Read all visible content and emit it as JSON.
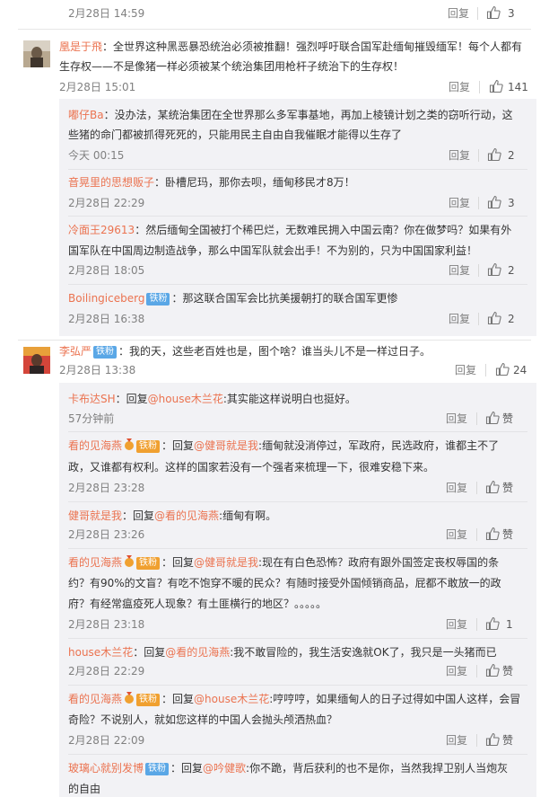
{
  "actions": {
    "reply": "回复",
    "like_icon": "thumbs-up-icon",
    "zan": "赞"
  },
  "colors": {
    "name": "#eb7350",
    "blue_badge": "#5aa7e6",
    "orange_badge": "#f0a030"
  },
  "comments": [
    {
      "id": "top",
      "time": "2月28日 14:59",
      "likes": "3"
    },
    {
      "id": "feng",
      "user": "凰是于飛",
      "text_line1": "：全世界这种黑恶暴恐统治必须被推翻！强烈呼吁联合国军赴缅甸摧毁缅军！每个人都有",
      "text_line2": "生存权——不是像猪一样必须被某个统治集团用枪杆子统治下的生存权！",
      "time": "2月28日 15:01",
      "likes": "141",
      "replies": [
        {
          "user": "嘟仔Ba",
          "line1": "：没办法，某统治集团在全世界那么多军事基地，再加上棱镜计划之类的窃听行动，这",
          "line2": "些猪的命门都被抓得死死的，只能用民主自由自我催眠才能得以生存了",
          "time": "今天 00:15",
          "likes": "2"
        },
        {
          "user": "音晃里的思想贩子",
          "line1": "：卧槽尼玛，那你去呗，缅甸移民才8万！",
          "time": "2月28日 22:29",
          "likes": "3"
        },
        {
          "user": "冷面王29613",
          "line1": "：然后缅甸全国被打个稀巴烂，无数难民拥入中国云南？你在做梦吗？如果有外",
          "line2": "国军队在中国周边制造战争，那么中国军队就会出手！不为别的，只为中国国家利益！",
          "time": "2月28日 18:05",
          "likes": "2"
        },
        {
          "user": "Boilingiceberg",
          "badge": "铁粉",
          "line1": "：那这联合国军会比抗美援朝打的联合国军更惨",
          "time": "2月28日 16:38",
          "likes": "2"
        }
      ]
    },
    {
      "id": "li",
      "user": "李弘严",
      "badge": "铁粉",
      "text_line1": "：我的天，这些老百姓也是，图个啥？谁当头儿不是一样过日子。",
      "time": "2月28日 13:38",
      "likes": "24",
      "replies": [
        {
          "user": "卡布达SH",
          "prefix": "：回复",
          "mention": "@house木兰花",
          "line1": ":其实能这样说明白也挺好。",
          "time": "57分钟前",
          "likes": "赞"
        },
        {
          "user": "看的见海燕",
          "badge": "铁粉",
          "prefix": "：回复",
          "mention": "@健哥就是我",
          "line1": ":缅甸就没消停过，军政府，民选政府，谁都主不了",
          "line2": "政，又谁都有权利。这样的国家若没有一个强者来梳理一下，很难安稳下来。",
          "time": "2月28日 23:28",
          "likes": "赞"
        },
        {
          "user": "健哥就是我",
          "prefix": "：回复",
          "mention": "@看的见海燕",
          "line1": ":缅甸有啊。",
          "time": "2月28日 23:26",
          "likes": "赞"
        },
        {
          "user": "看的见海燕",
          "badge": "铁粉",
          "prefix": "：回复",
          "mention": "@健哥就是我",
          "line1": ":现在有白色恐怖？政府有跟外国签定丧权辱国的条",
          "line2": "约？有90%的文盲？有吃不饱穿不暖的民众？有随时接受外国倾销商品，屁都不敢放一的政",
          "line3": "府？有经常瘟疫死人现象？有土匪横行的地区？。。。。。",
          "time": "2月28日 23:18",
          "likes": "1"
        },
        {
          "user": "house木兰花",
          "prefix": "：回复",
          "mention": "@看的见海燕",
          "line1": ":我不敢冒险的，我生活安逸就OK了，我只是一头猪而已",
          "time": "2月28日 22:29",
          "likes": "赞"
        },
        {
          "user": "看的见海燕",
          "badge": "铁粉",
          "prefix": "：回复",
          "mention": "@house木兰花",
          "line1": ":哼哼哼，如果缅甸人的日子过得如中国人这样，会冒",
          "line2": "奇险？不说别人，就如您这样的中国人会抛头颅洒热血？",
          "time": "2月28日 22:09",
          "likes": "赞"
        },
        {
          "user": "玻璃心就别发博",
          "badge": "铁粉",
          "prefix": "：回复",
          "mention": "@吟健歌",
          "line1": ":你不跪，背后获利的也不是你，当然我捍卫别人当炮灰",
          "line2": "的自由"
        }
      ]
    }
  ]
}
